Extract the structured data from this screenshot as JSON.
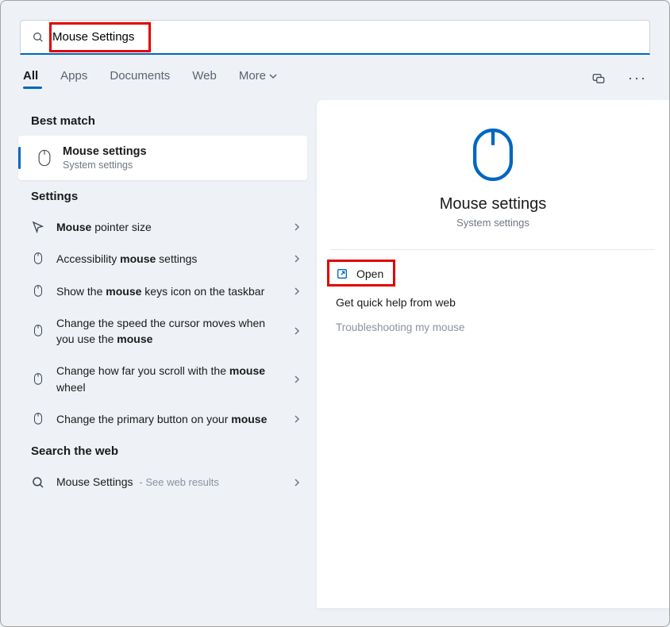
{
  "search": {
    "value": "Mouse Settings"
  },
  "tabs": {
    "all": "All",
    "apps": "Apps",
    "documents": "Documents",
    "web": "Web",
    "more": "More"
  },
  "sections": {
    "best_match": "Best match",
    "settings": "Settings",
    "search_web": "Search the web"
  },
  "best_match": {
    "title": "Mouse settings",
    "subtitle": "System settings"
  },
  "settings_items": [
    {
      "pre": "",
      "bold1": "Mouse",
      "mid": " pointer size",
      "bold2": "",
      "post": ""
    },
    {
      "pre": "Accessibility ",
      "bold1": "mouse",
      "mid": " settings",
      "bold2": "",
      "post": ""
    },
    {
      "pre": "Show the ",
      "bold1": "mouse",
      "mid": " keys icon on the taskbar",
      "bold2": "",
      "post": ""
    },
    {
      "pre": "Change the speed the cursor moves when you use the ",
      "bold1": "mouse",
      "mid": "",
      "bold2": "",
      "post": ""
    },
    {
      "pre": "Change how far you scroll with the ",
      "bold1": "mouse",
      "mid": " wheel",
      "bold2": "",
      "post": ""
    },
    {
      "pre": "Change the primary button on your ",
      "bold1": "mouse",
      "mid": "",
      "bold2": "",
      "post": ""
    }
  ],
  "web_item": {
    "title": "Mouse Settings",
    "suffix": "- See web results"
  },
  "detail": {
    "title": "Mouse settings",
    "subtitle": "System settings",
    "open": "Open",
    "quick_help": "Get quick help from web",
    "troubleshoot": "Troubleshooting my mouse"
  },
  "colors": {
    "accent": "#0067c0",
    "highlight": "#e30000"
  }
}
